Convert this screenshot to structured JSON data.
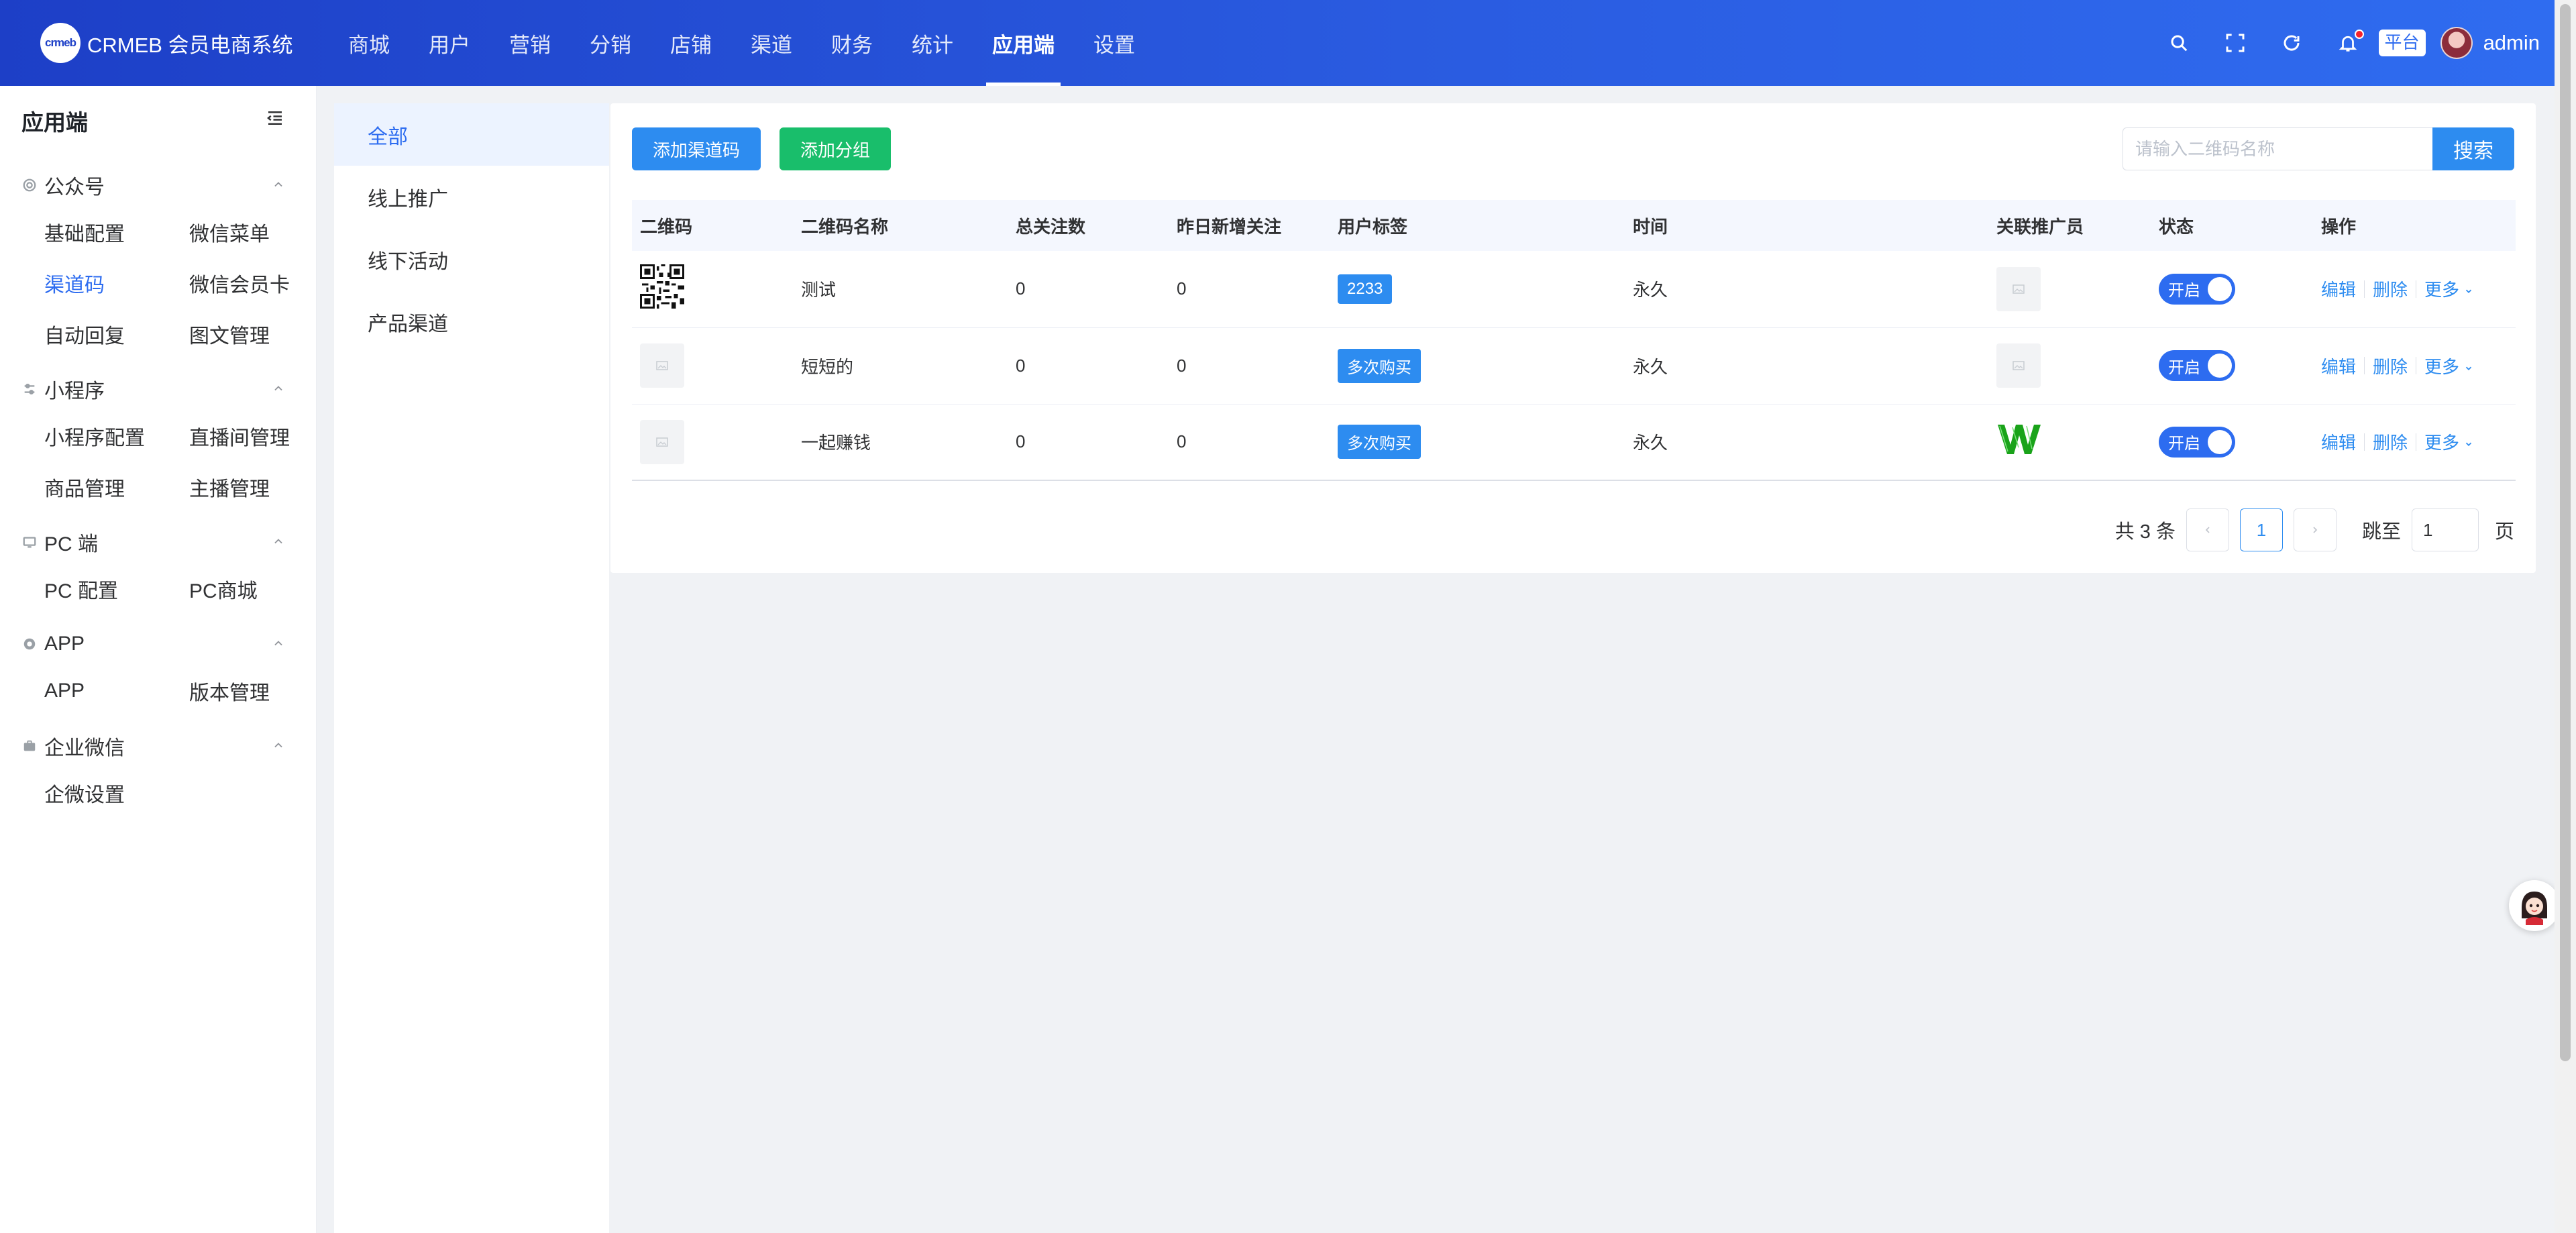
{
  "header": {
    "logo_text": "crmeb",
    "brand_name": "CRMEB 会员电商系统",
    "nav": [
      {
        "label": "商城"
      },
      {
        "label": "用户"
      },
      {
        "label": "营销"
      },
      {
        "label": "分销"
      },
      {
        "label": "店铺"
      },
      {
        "label": "渠道"
      },
      {
        "label": "财务"
      },
      {
        "label": "统计"
      },
      {
        "label": "应用端"
      },
      {
        "label": "设置"
      }
    ],
    "active_nav": "应用端",
    "platform_badge": "平台",
    "username": "admin"
  },
  "sidebar": {
    "title": "应用端",
    "groups": [
      {
        "title": "公众号",
        "items": [
          "基础配置",
          "微信菜单",
          "渠道码",
          "微信会员卡",
          "自动回复",
          "图文管理"
        ]
      },
      {
        "title": "小程序",
        "items": [
          "小程序配置",
          "直播间管理",
          "商品管理",
          "主播管理"
        ]
      },
      {
        "title": "PC 端",
        "items": [
          "PC 配置",
          "PC商城"
        ]
      },
      {
        "title": "APP",
        "items": [
          "APP",
          "版本管理"
        ]
      },
      {
        "title": "企业微信",
        "items": [
          "企微设置"
        ]
      }
    ],
    "active_item": "渠道码"
  },
  "categories": {
    "items": [
      "全部",
      "线上推广",
      "线下活动",
      "产品渠道"
    ],
    "active": "全部"
  },
  "toolbar": {
    "add_code_label": "添加渠道码",
    "add_group_label": "添加分组",
    "search_placeholder": "请输入二维码名称",
    "search_label": "搜索"
  },
  "table": {
    "columns": [
      "二维码",
      "二维码名称",
      "总关注数",
      "昨日新增关注",
      "用户标签",
      "时间",
      "关联推广员",
      "状态",
      "操作"
    ],
    "rows": [
      {
        "name": "测试",
        "total_follow": "0",
        "yesterday_new": "0",
        "tag": "2233",
        "time": "永久",
        "status": "开启"
      },
      {
        "name": "短短的",
        "total_follow": "0",
        "yesterday_new": "0",
        "tag": "多次购买",
        "time": "永久",
        "status": "开启"
      },
      {
        "name": "一起赚钱",
        "total_follow": "0",
        "yesterday_new": "0",
        "tag": "多次购买",
        "time": "永久",
        "status": "开启"
      }
    ],
    "actions": {
      "edit": "编辑",
      "delete": "删除",
      "more": "更多"
    }
  },
  "pagination": {
    "total_text": "共 3 条",
    "current_page": "1",
    "jump_label": "跳至",
    "jump_value": "1",
    "page_unit": "页"
  },
  "colors": {
    "header_start": "#1d3fc7",
    "header_end": "#2f6cf0",
    "primary": "#2d8cf0",
    "success": "#19be6b",
    "active_text": "#2d6cf0"
  }
}
